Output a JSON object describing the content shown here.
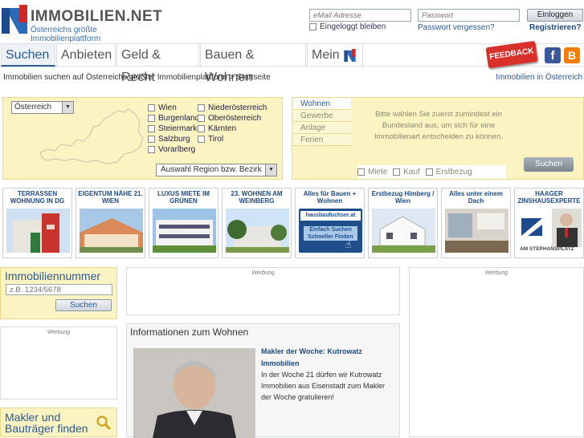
{
  "header": {
    "brand": "IMMOBILIEN.NET",
    "tagline": "Österreichs größte Immobilienplattform",
    "email_placeholder": "eMail Adresse",
    "password_placeholder": "Passwort",
    "login_label": "Einloggen",
    "remember_label": "Eingeloggt bleiben",
    "forgot_label": "Passwort vergessen?",
    "register_label": "Registrieren?",
    "feedback_label": "FEEDBACK"
  },
  "nav": {
    "items": [
      {
        "label": "Suchen"
      },
      {
        "label": "Anbieten"
      },
      {
        "label": "Geld & Recht"
      },
      {
        "label": "Bauen & Wohnen"
      },
      {
        "label": "Mein"
      }
    ]
  },
  "breadcrumb": {
    "text": "Immobilien suchen auf Österreichs größter Immobilienplattform > Startseite",
    "right_link": "Immobilien in Österreich"
  },
  "search": {
    "country_select": "Österreich",
    "states_col1": [
      "Wien",
      "Burgenland",
      "Steiermark",
      "Salzburg",
      "Vorarlberg"
    ],
    "states_col2": [
      "Niederösterreich",
      "Oberösterreich",
      "Kärnten",
      "Tirol"
    ],
    "region_select": "Auswahl Region bzw. Bezirk",
    "tabs": [
      "Wohnen",
      "Gewerbe",
      "Anlage",
      "Ferien"
    ],
    "hint": "Bitte wählen Sie zuerst zumindest ein Bundesland aus, um sich für eine Immobilienart entscheiden zu können.",
    "types": [
      "Miete",
      "Kauf",
      "Erstbezug"
    ],
    "search_button": "Suchen"
  },
  "tiles": [
    {
      "title": "TERRASSEN WOHNUNG IN DG"
    },
    {
      "title": "EIGENTUM NÄHE 21. WIEN"
    },
    {
      "title": "LUXUS MIETE IM GRÜNEN"
    },
    {
      "title": "23. WOHNEN AM WEINBERG"
    },
    {
      "title": "Alles für Bauen + Wohnen",
      "line1": "hausbaufuchser.at",
      "line2": "Einfach Suchen",
      "line3": "Schneller Finden"
    },
    {
      "title": "Erstbezug Himberg / Wien"
    },
    {
      "title": "Alles unter einem Dach"
    },
    {
      "title": "HAAGER ZINSHAUSEXPERTE",
      "caption": "AM STEPHANSPLATZ"
    }
  ],
  "immo_number": {
    "title": "Immobiliennummer",
    "placeholder": "z.B. 1234/5678",
    "button": "Suchen"
  },
  "ad_label": "Werbung",
  "info": {
    "title": "Informationen zum Wohnen",
    "headline": "Makler der Woche: Kutrowatz Immobilien",
    "body": "In der Woche 21 dürfen wir Kutrowatz Immobilien aus Eisenstadt zum Makler der Woche gratulieren!"
  },
  "makler": {
    "title_line1": "Makler und",
    "title_line2": "Bauträger finden"
  },
  "colors": {
    "accent": "#2a5a94",
    "panel": "#fbf3c2",
    "feedback": "#d8302a"
  }
}
